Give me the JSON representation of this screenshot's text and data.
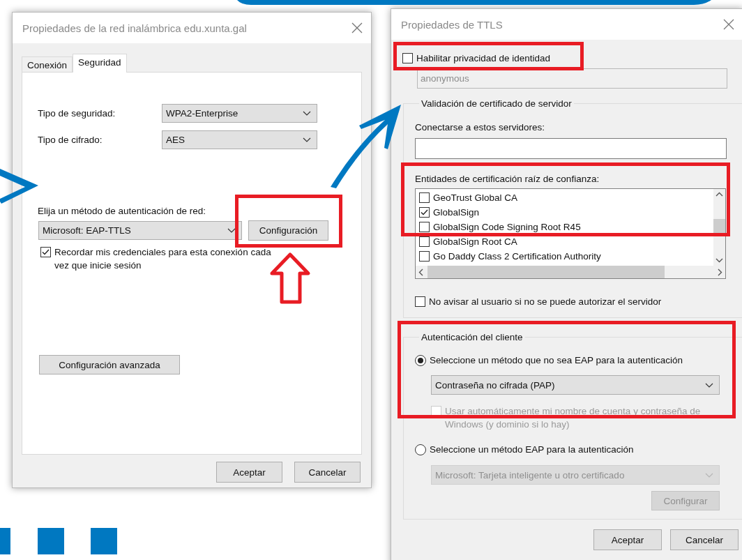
{
  "network_dialog": {
    "title": "Propiedades de la red inalámbrica edu.xunta.gal",
    "tabs": [
      {
        "label": "Conexión",
        "selected": false
      },
      {
        "label": "Seguridad",
        "selected": true
      }
    ],
    "security_type": {
      "label": "Tipo de seguridad:",
      "value": "WPA2-Enterprise"
    },
    "encryption_type": {
      "label": "Tipo de cifrado:",
      "value": "AES"
    },
    "auth_method": {
      "label": "Elija un método de autenticación de red:",
      "value": "Microsoft: EAP-TTLS"
    },
    "settings_button": "Configuración",
    "remember_credentials": {
      "label": "Recordar mis credenciales para esta conexión cada vez que inicie sesión",
      "checked": true
    },
    "advanced_button": "Configuración avanzada",
    "buttons": [
      "Aceptar",
      "Cancelar"
    ]
  },
  "ttls_dialog": {
    "title": "Propiedades de TTLS",
    "identity_privacy": {
      "label": "Habilitar privacidad de identidad",
      "checked": false
    },
    "identity_field": {
      "value": "anonymous",
      "disabled": true
    },
    "server_validation": {
      "legend": "Validación de certificado de servidor",
      "servers_label": "Conectarse a estos servidores:",
      "roots_label": "Entidades de certificación raíz de confianza:",
      "roots": [
        {
          "label": "GeoTrust Global CA",
          "checked": false
        },
        {
          "label": "GlobalSign",
          "checked": true
        },
        {
          "label": "GlobalSign Code Signing Root R45",
          "checked": false
        },
        {
          "label": "GlobalSign Root CA",
          "checked": false
        },
        {
          "label": "Go Daddy Class 2 Certification Authority",
          "checked": false
        }
      ],
      "no_prompt": {
        "label": "No avisar al usuario si no se puede autorizar el servidor",
        "checked": false
      }
    },
    "client_auth": {
      "legend": "Autenticación del cliente",
      "options": [
        {
          "label": "Seleccione un método que no sea EAP para la autenticación",
          "selected": true,
          "value": "Contraseña no cifrada (PAP)",
          "disabled": false
        },
        {
          "label": "Seleccione un método EAP para la autenticación",
          "selected": false,
          "value": "Microsoft: Tarjeta inteligente u otro certificado",
          "disabled": true
        }
      ],
      "windows_credentials": {
        "label": "Usar automáticamente mi nombre de cuenta y contraseña de Windows (y dominio si lo hay)",
        "checked": false,
        "disabled": true
      },
      "configure_button": {
        "label": "Configurar",
        "disabled": true
      }
    },
    "buttons": [
      "Aceptar",
      "Cancelar"
    ]
  }
}
